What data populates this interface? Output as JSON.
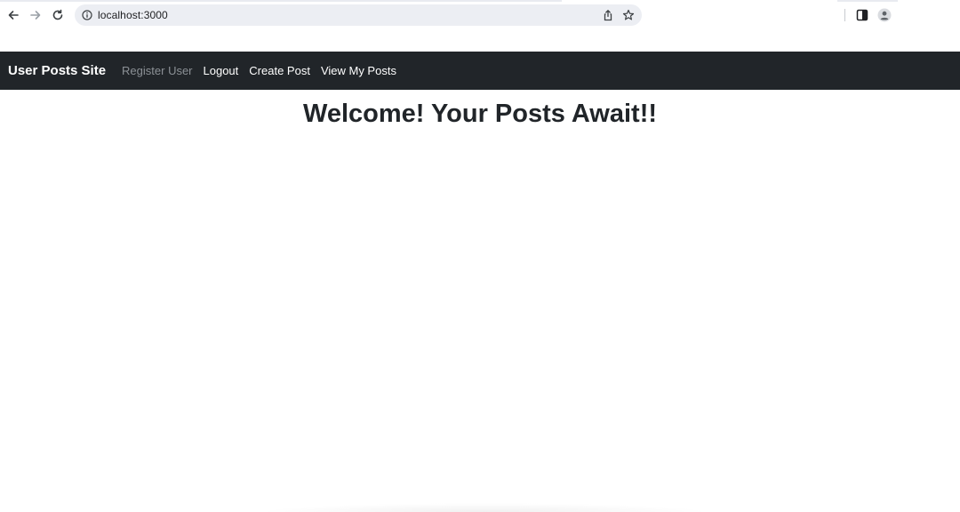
{
  "browser": {
    "url": "localhost:3000",
    "icons": {
      "back": "arrow-left-icon",
      "forward": "arrow-right-icon",
      "reload": "reload-icon",
      "site_info": "info-icon",
      "share": "share-icon",
      "bookmark": "star-icon",
      "side_panel": "side-panel-icon",
      "profile": "profile-icon"
    }
  },
  "navbar": {
    "brand": "User Posts Site",
    "links": [
      {
        "label": "Register User",
        "state": "disabled"
      },
      {
        "label": "Logout"
      },
      {
        "label": "Create Post"
      },
      {
        "label": "View My Posts"
      }
    ],
    "background": "#212529"
  },
  "main": {
    "heading": "Welcome! Your Posts Await!!"
  }
}
